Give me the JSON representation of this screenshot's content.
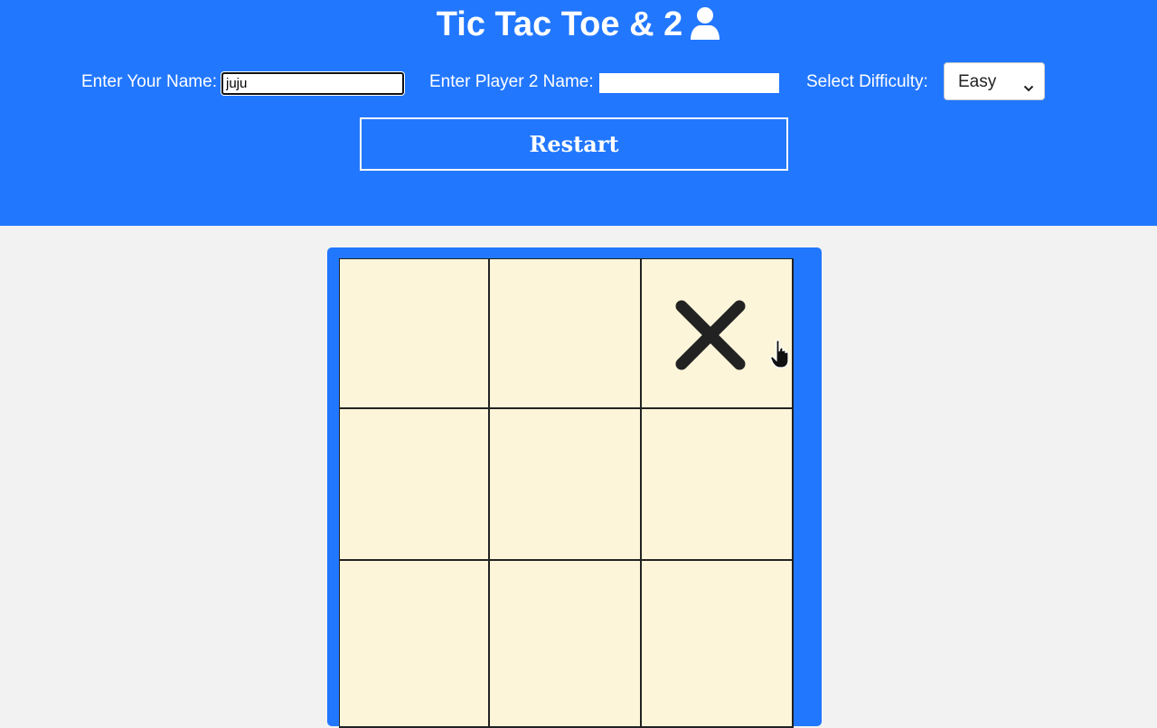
{
  "header": {
    "title": "Tic Tac Toe & 2",
    "title_icon": "user-icon",
    "background_color": "#2277ff"
  },
  "form": {
    "player1_label": "Enter Your Name:",
    "player1_value": "juju",
    "player2_label": "Enter Player 2 Name:",
    "player2_value": "",
    "difficulty_label": "Select Difficulty:",
    "difficulty_value": "Easy"
  },
  "restart_label": "Restart",
  "board": {
    "cells": [
      "",
      "",
      "X",
      "",
      "",
      "",
      "",
      "",
      ""
    ],
    "cell_color": "#fdf5da",
    "frame_color": "#2277ff",
    "mark_color": "#222222"
  },
  "cursor": "hand-pointer-icon"
}
